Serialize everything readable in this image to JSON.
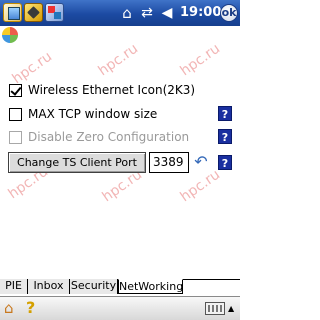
{
  "status_bar": {
    "time": "19:00",
    "ok_label": "ok",
    "icons": [
      "app-icon",
      "tools-icon",
      "settings-icon",
      "home-icon",
      "connectivity-icon",
      "volume-icon"
    ]
  },
  "watermark_text": "hpc.ru",
  "options": [
    {
      "label": "Wireless Ethernet Icon(2K3)",
      "checked": true,
      "enabled": true
    },
    {
      "label": "MAX TCP window size",
      "checked": false,
      "enabled": true
    },
    {
      "label": "Disable Zero Configuration",
      "checked": false,
      "enabled": false
    }
  ],
  "help_label": "?",
  "ts_port": {
    "button_label": "Change TS Client Port",
    "value": "3389"
  },
  "tabs": [
    {
      "label": "PIE",
      "active": false
    },
    {
      "label": "Inbox",
      "active": false
    },
    {
      "label": "Security",
      "active": false
    },
    {
      "label": "NetWorking",
      "active": true
    }
  ],
  "menu": {
    "help_glyph": "?"
  }
}
